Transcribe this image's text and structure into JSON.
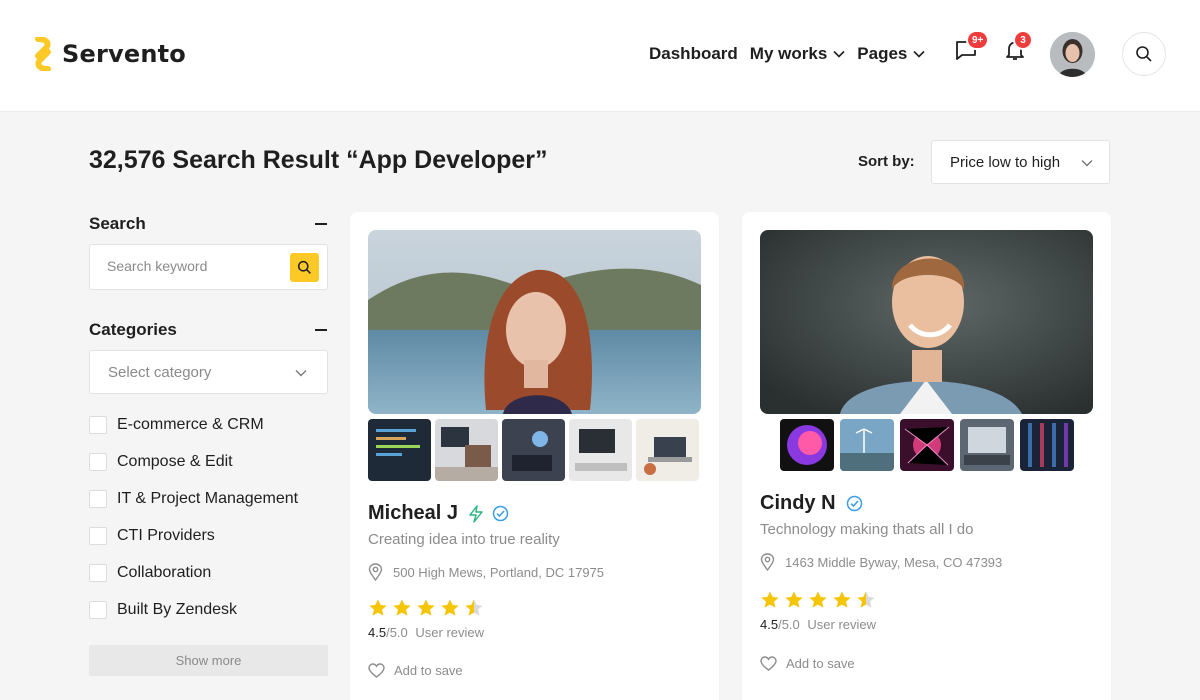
{
  "brand": {
    "name": "Servento",
    "logo_color": "#fdc926"
  },
  "nav": {
    "dashboard": "Dashboard",
    "my_works": "My works",
    "pages": "Pages",
    "messages_badge": "9+",
    "notifications_badge": "3"
  },
  "results": {
    "title": "32,576 Search Result “App Developer”",
    "sort_label": "Sort by:",
    "sort_value": "Price low to high"
  },
  "sidebar": {
    "search_heading": "Search",
    "search_placeholder": "Search keyword",
    "categories_heading": "Categories",
    "category_placeholder": "Select category",
    "categories": [
      {
        "label": "E-commerce & CRM"
      },
      {
        "label": "Compose & Edit"
      },
      {
        "label": "IT & Project Management"
      },
      {
        "label": "CTI Providers"
      },
      {
        "label": "Collaboration"
      },
      {
        "label": "Built By Zendesk"
      }
    ],
    "show_more": "Show more"
  },
  "cards": [
    {
      "name": "Micheal J",
      "tagline": "Creating idea into true reality",
      "location": "500 High Mews, Portland, DC 17975",
      "rating": "4.5",
      "rating_out": "/5.0",
      "review_label": "User review",
      "save_label": "Add to save",
      "stars": 4.5
    },
    {
      "name": "Cindy N",
      "tagline": "Technology making thats all I do",
      "location": "1463 Middle Byway, Mesa, CO 47393",
      "rating": "4.5",
      "rating_out": "/5.0",
      "review_label": "User review",
      "save_label": "Add to save",
      "stars": 4.5
    }
  ],
  "colors": {
    "accent": "#fdc926",
    "badge": "#ef3d3d",
    "verified": "#3b9ce8",
    "bolt": "#27b47e",
    "star": "#f7c500"
  }
}
